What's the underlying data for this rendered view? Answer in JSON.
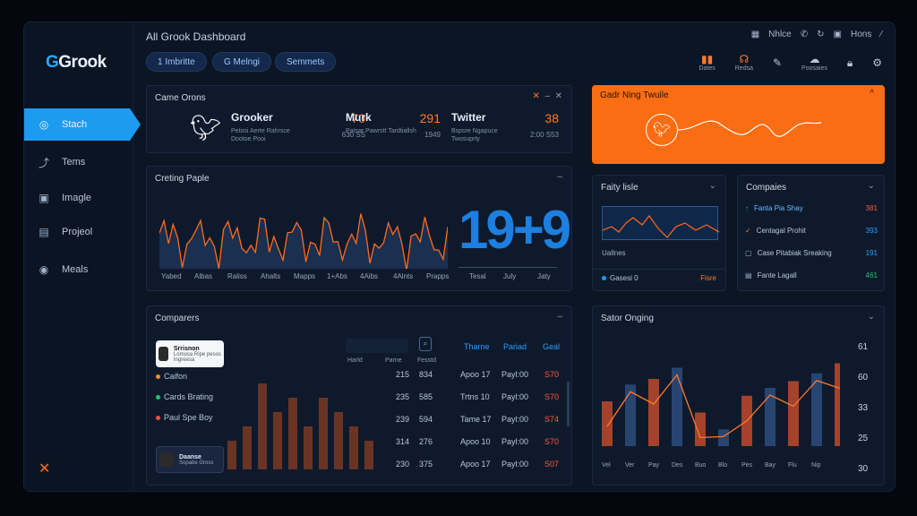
{
  "app": {
    "logo_prefix": "G",
    "logo_text": "Grook",
    "title": "All Grook Dashboard"
  },
  "sidebar": {
    "items": [
      {
        "label": "Stach",
        "icon": "stack-icon"
      },
      {
        "label": "Tems",
        "icon": "terms-icon"
      },
      {
        "label": "Imagle",
        "icon": "image-icon"
      },
      {
        "label": "Projeol",
        "icon": "project-icon"
      },
      {
        "label": "Meals",
        "icon": "meals-icon"
      }
    ]
  },
  "chips": [
    "1 Imbritte",
    "G Melngi",
    "Semmets"
  ],
  "topright": {
    "a": "Nhlce",
    "b": "Hons"
  },
  "toolbar": {
    "b1": "Dates",
    "b2": "Redsa",
    "b3": "Poosaies"
  },
  "game": {
    "title": "Came Orons",
    "services": [
      {
        "name": "Grooker",
        "num": "70",
        "sub": "Petosi Aerte Rahrsce Dootoe Pooi",
        "sn": "630 SS"
      },
      {
        "name": "Murk",
        "num": "291",
        "sub": "Patsar Pawrstt Tardtiallsh",
        "sn": "1949"
      },
      {
        "name": "Twitter",
        "num": "38",
        "sub": "Bspsre Ngapuce Twosuprty",
        "sn": "2:00 S53"
      }
    ]
  },
  "crating": {
    "title": "Creting Paple",
    "big": "19+9",
    "xlabels": [
      "Yabed",
      "Albas",
      "Raliss",
      "Ahalts",
      "Mapps",
      "1+Abs",
      "4Aibs",
      "4Alnts",
      "Prapps"
    ],
    "xlabels2": [
      "Tesal",
      "July",
      "Jaty"
    ]
  },
  "compare_top": {
    "title": "Gadr Ning Twuile"
  },
  "faity": {
    "title": "Faity lisle",
    "label": "Uallnes",
    "foot": "Gasesi 0",
    "foot_right": "Fisre"
  },
  "compagles": {
    "title": "Compaies",
    "rows": [
      {
        "label": "Fanta Pia Shay",
        "value": "381",
        "icon": "pin-icon"
      },
      {
        "label": "Centagal Prohit",
        "value": "393",
        "icon": "check-icon"
      },
      {
        "label": "Case Pitabiak Sreaking",
        "value": "191",
        "icon": "box-icon"
      },
      {
        "label": "Fante Lagall",
        "value": "461",
        "icon": "doc-icon"
      }
    ]
  },
  "comparers": {
    "title": "Comparers",
    "card1": {
      "t1": "Srrisnon",
      "t2": "Lomosa Ripe pesos Ingreesa"
    },
    "card2": {
      "t1": "Daanse",
      "t2": "Sopabe Gross"
    },
    "legend": [
      {
        "label": "Caifon",
        "color": "#ff8a2a"
      },
      {
        "label": "Cards Brating",
        "color": "#21c46a"
      },
      {
        "label": "Paul Spe Boy",
        "color": "#ff4a3a"
      }
    ],
    "subhdr": [
      "Harld",
      "Parne",
      "Fesstd"
    ],
    "headers": [
      "Tharne",
      "Pariad",
      "Geal"
    ],
    "rows": [
      [
        "215",
        "834",
        "Apoo 17",
        "Payl:00",
        "S70"
      ],
      [
        "235",
        "585",
        "Trtns 10",
        "Payl:00",
        "S70"
      ],
      [
        "239",
        "594",
        "Tame 17",
        "Payl:00",
        "S74"
      ],
      [
        "314",
        "276",
        "Apoo 10",
        "Payl:00",
        "S70"
      ],
      [
        "230",
        "375",
        "Apoo 17",
        "Payl:00",
        "S07"
      ]
    ],
    "bar_values": [
      2,
      3,
      6,
      4,
      5,
      3,
      5,
      4,
      3,
      2
    ]
  },
  "sator": {
    "title": "Sator Onging",
    "ylabels": [
      "61",
      "60",
      "33",
      "25",
      "30"
    ],
    "xlabels": [
      "Vel",
      "Ver",
      "Pay",
      "Des",
      "Buo",
      "Blo",
      "Pes",
      "Bay",
      "Flu",
      "Nip"
    ],
    "bars": [
      40,
      55,
      60,
      70,
      30,
      15,
      45,
      52,
      58,
      65,
      74
    ]
  }
}
